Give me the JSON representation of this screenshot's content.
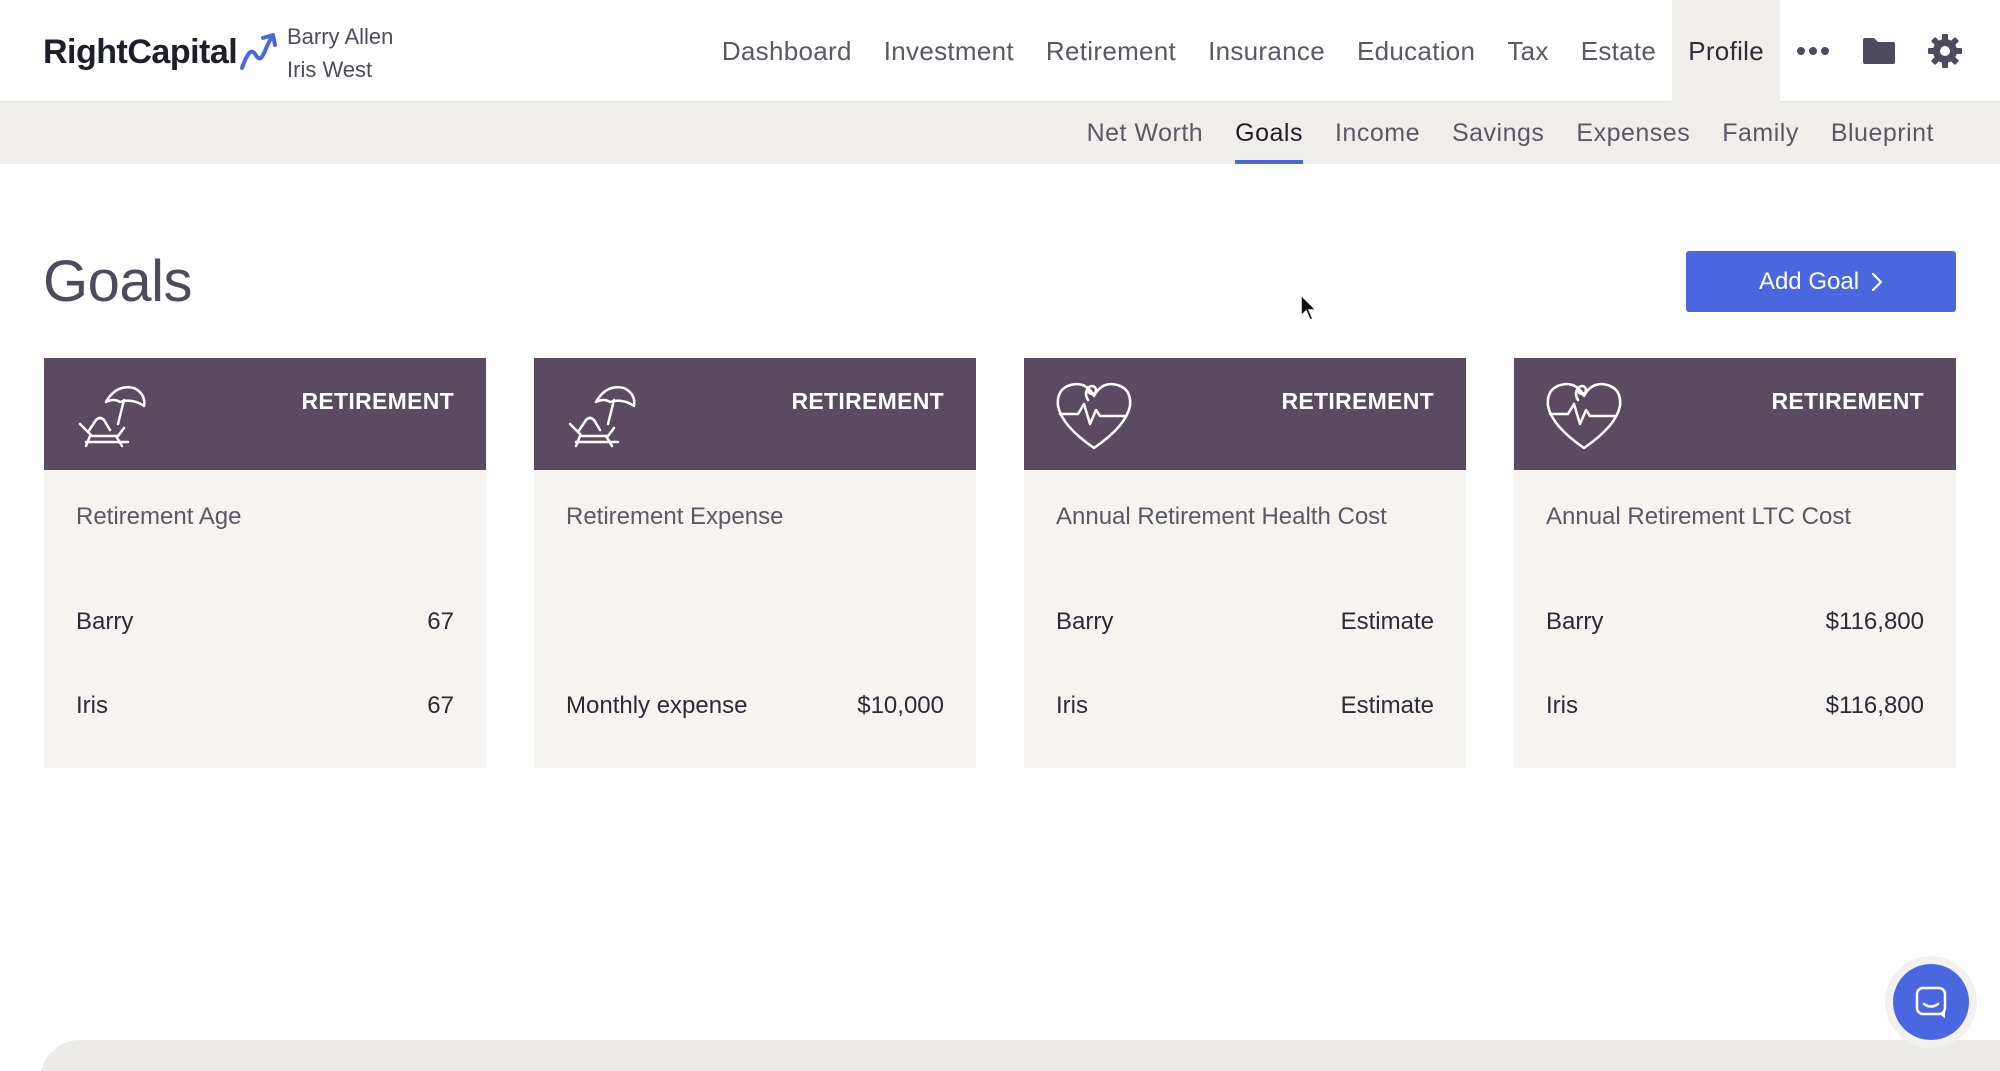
{
  "brand": {
    "name": "RightCapital"
  },
  "clients": {
    "primary": "Barry Allen",
    "spouse": "Iris West"
  },
  "main_nav": [
    {
      "label": "Dashboard"
    },
    {
      "label": "Investment"
    },
    {
      "label": "Retirement"
    },
    {
      "label": "Insurance"
    },
    {
      "label": "Education"
    },
    {
      "label": "Tax"
    },
    {
      "label": "Estate"
    },
    {
      "label": "Profile"
    }
  ],
  "nav_icons": [
    "more-icon",
    "folder-icon",
    "gear-icon"
  ],
  "sub_nav": [
    {
      "label": "Net Worth"
    },
    {
      "label": "Goals"
    },
    {
      "label": "Income"
    },
    {
      "label": "Savings"
    },
    {
      "label": "Expenses"
    },
    {
      "label": "Family"
    },
    {
      "label": "Blueprint"
    }
  ],
  "page": {
    "title": "Goals",
    "add_button_label": "Add Goal"
  },
  "colors": {
    "accent": "#4a67e0",
    "card_header": "#5a4b61",
    "card_body": "#f6f4f0"
  },
  "cards": [
    {
      "category": "RETIREMENT",
      "icon": "beach-chair-icon",
      "title": "Retirement Age",
      "rows": [
        {
          "label": "Barry",
          "value": "67"
        },
        {
          "label": "Iris",
          "value": "67"
        }
      ]
    },
    {
      "category": "RETIREMENT",
      "icon": "beach-chair-icon",
      "title": "Retirement Expense",
      "rows": [
        {
          "label": "Monthly expense",
          "value": "$10,000"
        }
      ]
    },
    {
      "category": "RETIREMENT",
      "icon": "heart-pulse-icon",
      "title": "Annual Retirement Health Cost",
      "rows": [
        {
          "label": "Barry",
          "value": "Estimate"
        },
        {
          "label": "Iris",
          "value": "Estimate"
        }
      ]
    },
    {
      "category": "RETIREMENT",
      "icon": "heart-pulse-icon",
      "title": "Annual Retirement LTC Cost",
      "rows": [
        {
          "label": "Barry",
          "value": "$116,800"
        },
        {
          "label": "Iris",
          "value": "$116,800"
        }
      ]
    }
  ]
}
